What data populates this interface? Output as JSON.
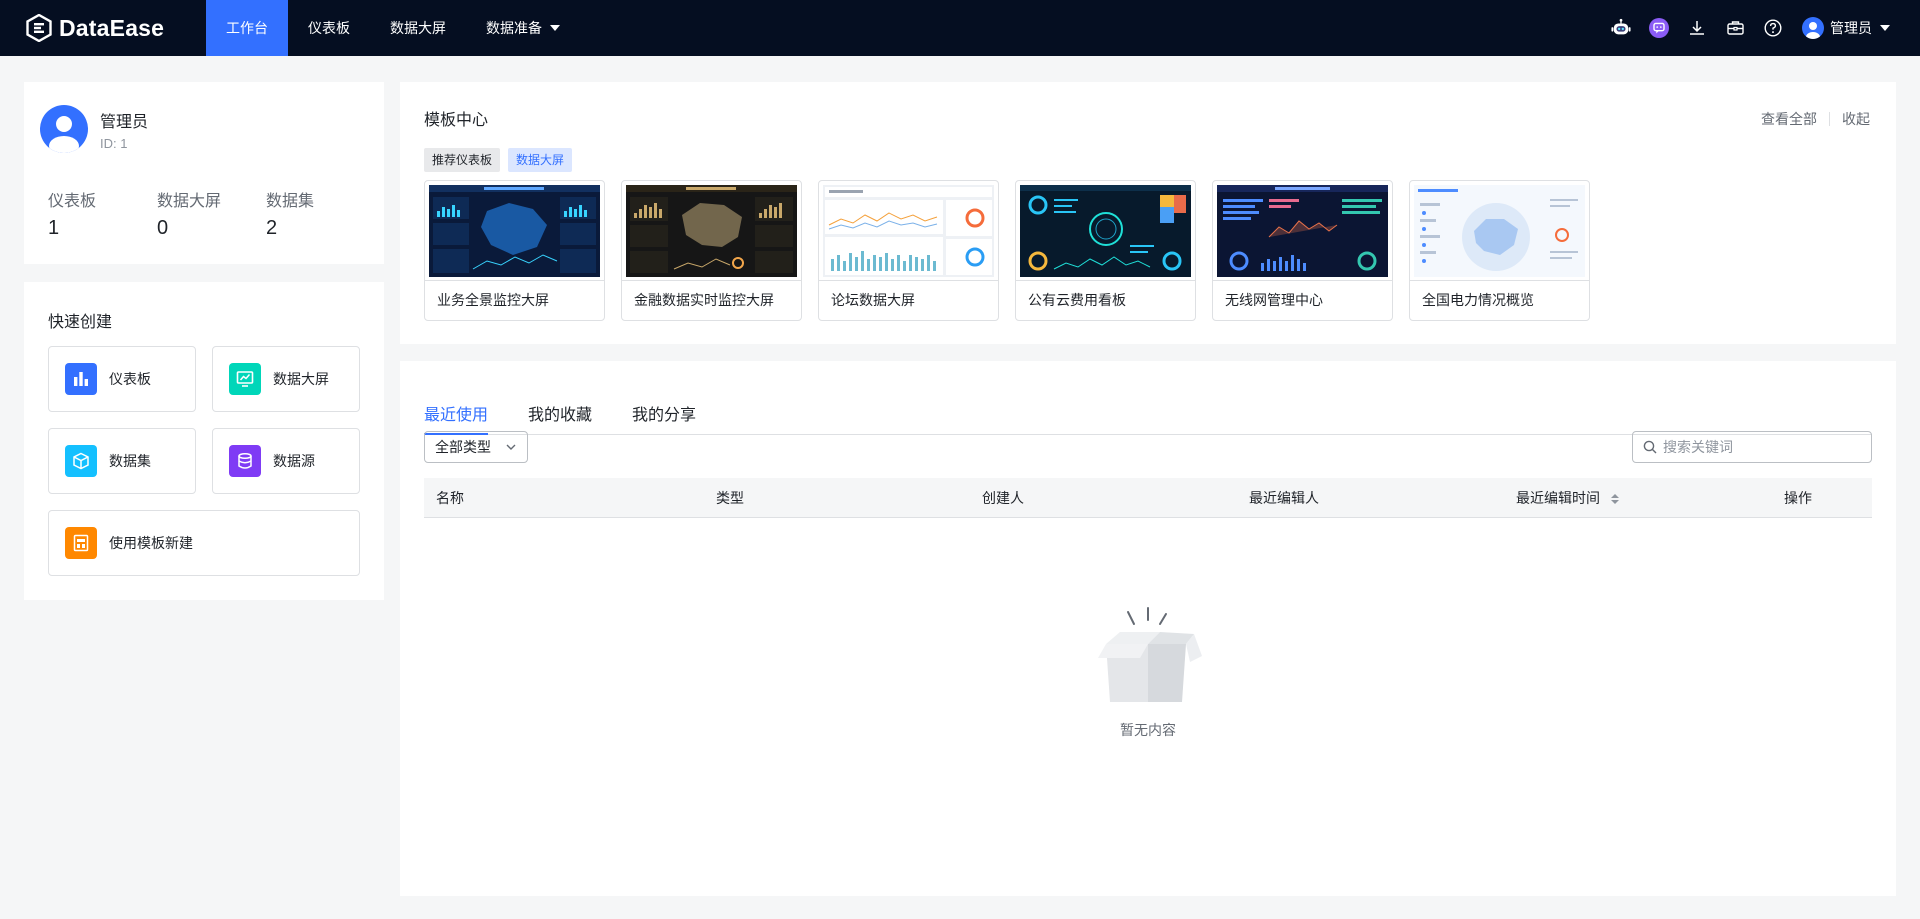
{
  "app": {
    "logo_text": "DataEase"
  },
  "nav": {
    "items": [
      {
        "label": "工作台",
        "active": true
      },
      {
        "label": "仪表板",
        "active": false
      },
      {
        "label": "数据大屏",
        "active": false
      },
      {
        "label": "数据准备",
        "active": false,
        "dropdown": true
      }
    ]
  },
  "topbar": {
    "icons": [
      "robot-icon",
      "chat-icon",
      "download-icon",
      "toolbox-icon",
      "help-icon"
    ],
    "user_name": "管理员"
  },
  "profile": {
    "name": "管理员",
    "id_text": "ID: 1",
    "stats": [
      {
        "label": "仪表板",
        "value": "1"
      },
      {
        "label": "数据大屏",
        "value": "0"
      },
      {
        "label": "数据集",
        "value": "2"
      }
    ]
  },
  "quick_create": {
    "title": "快速创建",
    "items": [
      {
        "label": "仪表板",
        "icon": "bar-chart-icon",
        "color": "#3370ff"
      },
      {
        "label": "数据大屏",
        "icon": "screen-icon",
        "color": "#00d6b9"
      },
      {
        "label": "数据集",
        "icon": "cube-icon",
        "color": "#14c0ff"
      },
      {
        "label": "数据源",
        "icon": "database-icon",
        "color": "#7f3bf5"
      },
      {
        "label": "使用模板新建",
        "icon": "template-icon",
        "color": "#ff8800"
      }
    ]
  },
  "template_center": {
    "title": "模板中心",
    "view_all": "查看全部",
    "collapse": "收起",
    "tags": [
      {
        "label": "推荐仪表板",
        "active": false
      },
      {
        "label": "数据大屏",
        "active": true
      }
    ],
    "templates": [
      {
        "name": "业务全景监控大屏",
        "theme": "dark-blue"
      },
      {
        "name": "金融数据实时监控大屏",
        "theme": "dark-gold"
      },
      {
        "name": "论坛数据大屏",
        "theme": "light"
      },
      {
        "name": "公有云费用看板",
        "theme": "dark-cyan"
      },
      {
        "name": "无线网管理中心",
        "theme": "dark-navy"
      },
      {
        "name": "全国电力情况概览",
        "theme": "light-blue"
      }
    ]
  },
  "recent": {
    "tabs": [
      {
        "label": "最近使用",
        "active": true
      },
      {
        "label": "我的收藏",
        "active": false
      },
      {
        "label": "我的分享",
        "active": false
      }
    ],
    "type_filter": "全部类型",
    "search_placeholder": "搜索关键词",
    "columns": [
      "名称",
      "类型",
      "创建人",
      "最近编辑人",
      "最近编辑时间",
      "操作"
    ],
    "empty_text": "暂无内容"
  },
  "colors": {
    "accent": "#3370ff",
    "topbar_bg": "#050e21"
  }
}
